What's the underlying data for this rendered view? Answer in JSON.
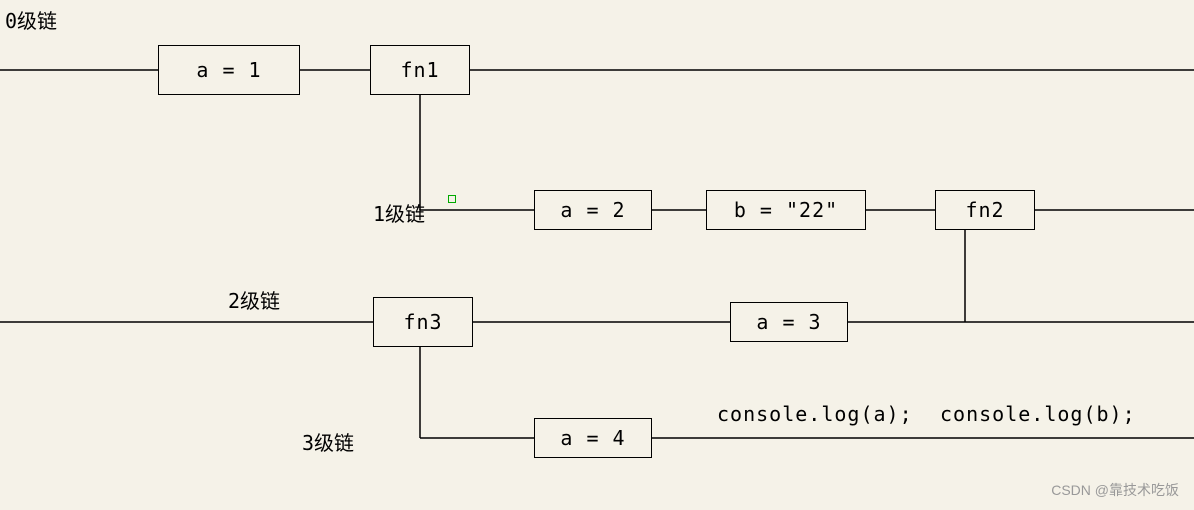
{
  "levels": {
    "l0": "0级链",
    "l1": "1级链",
    "l2": "2级链",
    "l3": "3级链"
  },
  "boxes": {
    "a1": "a = 1",
    "fn1": "fn1",
    "a2": "a = 2",
    "b22": "b = \"22\"",
    "fn2": "fn2",
    "fn3": "fn3",
    "a3": "a = 3",
    "a4": "a = 4"
  },
  "statements": {
    "logA": "console.log(a);",
    "logB": "console.log(b);"
  },
  "watermark": "CSDN @靠技术吃饭"
}
